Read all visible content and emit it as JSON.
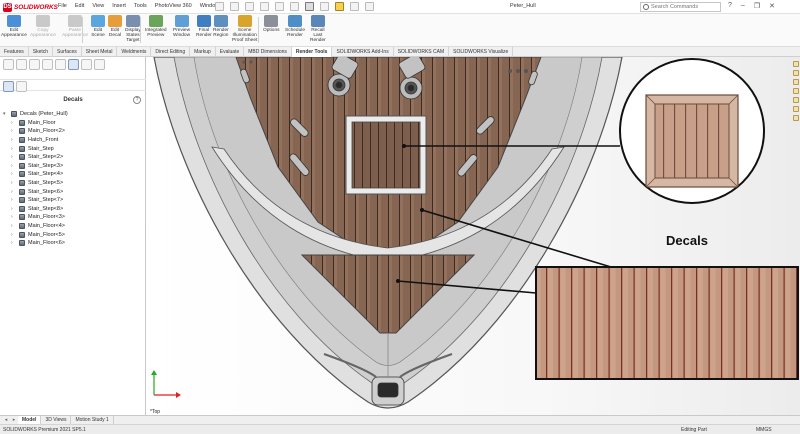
{
  "app": {
    "logo_prefix": "DS",
    "logo_text": "SOLIDWORKS",
    "document_title": "Peter_Hull",
    "search_placeholder": "Search Commands",
    "window_controls": [
      "?",
      "–",
      "❐",
      "✕"
    ]
  },
  "menu": [
    "File",
    "Edit",
    "View",
    "Insert",
    "Tools",
    "PhotoView 360",
    "Window"
  ],
  "command_manager": {
    "buttons": [
      {
        "label": "Edit\nAppearance",
        "icon": "edit-appearance-icon",
        "enabled": true,
        "color": "#4a8fd8"
      },
      {
        "label": "Copy\nAppearance",
        "icon": "copy-appearance-icon",
        "enabled": false,
        "color": "#c9c9c9"
      },
      {
        "label": "Paste\nAppearance",
        "icon": "paste-appearance-icon",
        "enabled": false,
        "color": "#c9c9c9"
      },
      {
        "label": "Edit\nScene",
        "icon": "edit-scene-icon",
        "enabled": true,
        "color": "#5aa6df"
      },
      {
        "label": "Edit\nDecal",
        "icon": "edit-decal-icon",
        "enabled": true,
        "color": "#e89d3b"
      },
      {
        "label": "Display\nStates\nTarget",
        "icon": "display-states-icon",
        "enabled": true,
        "color": "#7a8fb0"
      },
      {
        "label": "Integrated\nPreview",
        "icon": "integrated-preview-icon",
        "enabled": true,
        "color": "#6aa55a"
      },
      {
        "label": "Preview\nWindow",
        "icon": "preview-window-icon",
        "enabled": true,
        "color": "#5f9fd6"
      },
      {
        "label": "Final\nRender",
        "icon": "final-render-icon",
        "enabled": true,
        "color": "#3f7fbf"
      },
      {
        "label": "Render\nRegion",
        "icon": "render-region-icon",
        "enabled": true,
        "color": "#5f8fbf"
      },
      {
        "label": "Scene\nIllumination\nProof Sheet",
        "icon": "scene-illumination-icon",
        "enabled": true,
        "color": "#d8a42c"
      },
      {
        "label": "Options",
        "icon": "options-icon",
        "enabled": true,
        "color": "#8a8f99"
      },
      {
        "label": "Schedule\nRender",
        "icon": "schedule-render-icon",
        "enabled": true,
        "color": "#4f8fc8"
      },
      {
        "label": "Recall\nLast\nRender",
        "icon": "recall-render-icon",
        "enabled": true,
        "color": "#5b86b8"
      }
    ]
  },
  "tabs": [
    "Features",
    "Sketch",
    "Surfaces",
    "Sheet Metal",
    "Weldments",
    "Direct Editing",
    "Markup",
    "Evaluate",
    "MBD Dimensions",
    "Render Tools",
    "SOLIDWORKS Add-Ins",
    "SOLIDWORKS CAM",
    "SOLIDWORKS Visualize"
  ],
  "active_tab": "Render Tools",
  "left_panel": {
    "header": "Decals",
    "help": "?",
    "tree": [
      {
        "label": "Decals (Peter_Hull)",
        "level": 0,
        "expand": "▾"
      },
      {
        "label": "Main_Floor",
        "level": 1,
        "expand": "›"
      },
      {
        "label": "Main_Floor<2>",
        "level": 1,
        "expand": "›"
      },
      {
        "label": "Hatch_Front",
        "level": 1,
        "expand": "›"
      },
      {
        "label": "Stair_Step",
        "level": 1,
        "expand": "›"
      },
      {
        "label": "Stair_Step<2>",
        "level": 1,
        "expand": "›"
      },
      {
        "label": "Stair_Step<3>",
        "level": 1,
        "expand": "›"
      },
      {
        "label": "Stair_Step<4>",
        "level": 1,
        "expand": "›"
      },
      {
        "label": "Stair_Step<5>",
        "level": 1,
        "expand": "›"
      },
      {
        "label": "Stair_Step<6>",
        "level": 1,
        "expand": "›"
      },
      {
        "label": "Stair_Step<7>",
        "level": 1,
        "expand": "›"
      },
      {
        "label": "Stair_Step<8>",
        "level": 1,
        "expand": "›"
      },
      {
        "label": "Main_Floor<3>",
        "level": 1,
        "expand": "›"
      },
      {
        "label": "Main_Floor<4>",
        "level": 1,
        "expand": "›"
      },
      {
        "label": "Main_Floor<5>",
        "level": 1,
        "expand": "›"
      },
      {
        "label": "Main_Floor<6>",
        "level": 1,
        "expand": "›"
      }
    ]
  },
  "viewport": {
    "callout_title": "Decals",
    "view_label": "*Top",
    "colors": {
      "hull": "#dcdcdc",
      "deck_wood": "#8a6a56",
      "plank_line": "#5a3e31",
      "hatch_frame": "#e8e8e8",
      "callout_wood": "#c89a7f"
    }
  },
  "bottom_tabs": [
    "Model",
    "3D Views",
    "Motion Study 1"
  ],
  "active_bottom_tab": "Model",
  "status": {
    "version": "SOLIDWORKS Premium 2021 SP5.1",
    "mode": "Editing Part",
    "units": "MMGS"
  }
}
